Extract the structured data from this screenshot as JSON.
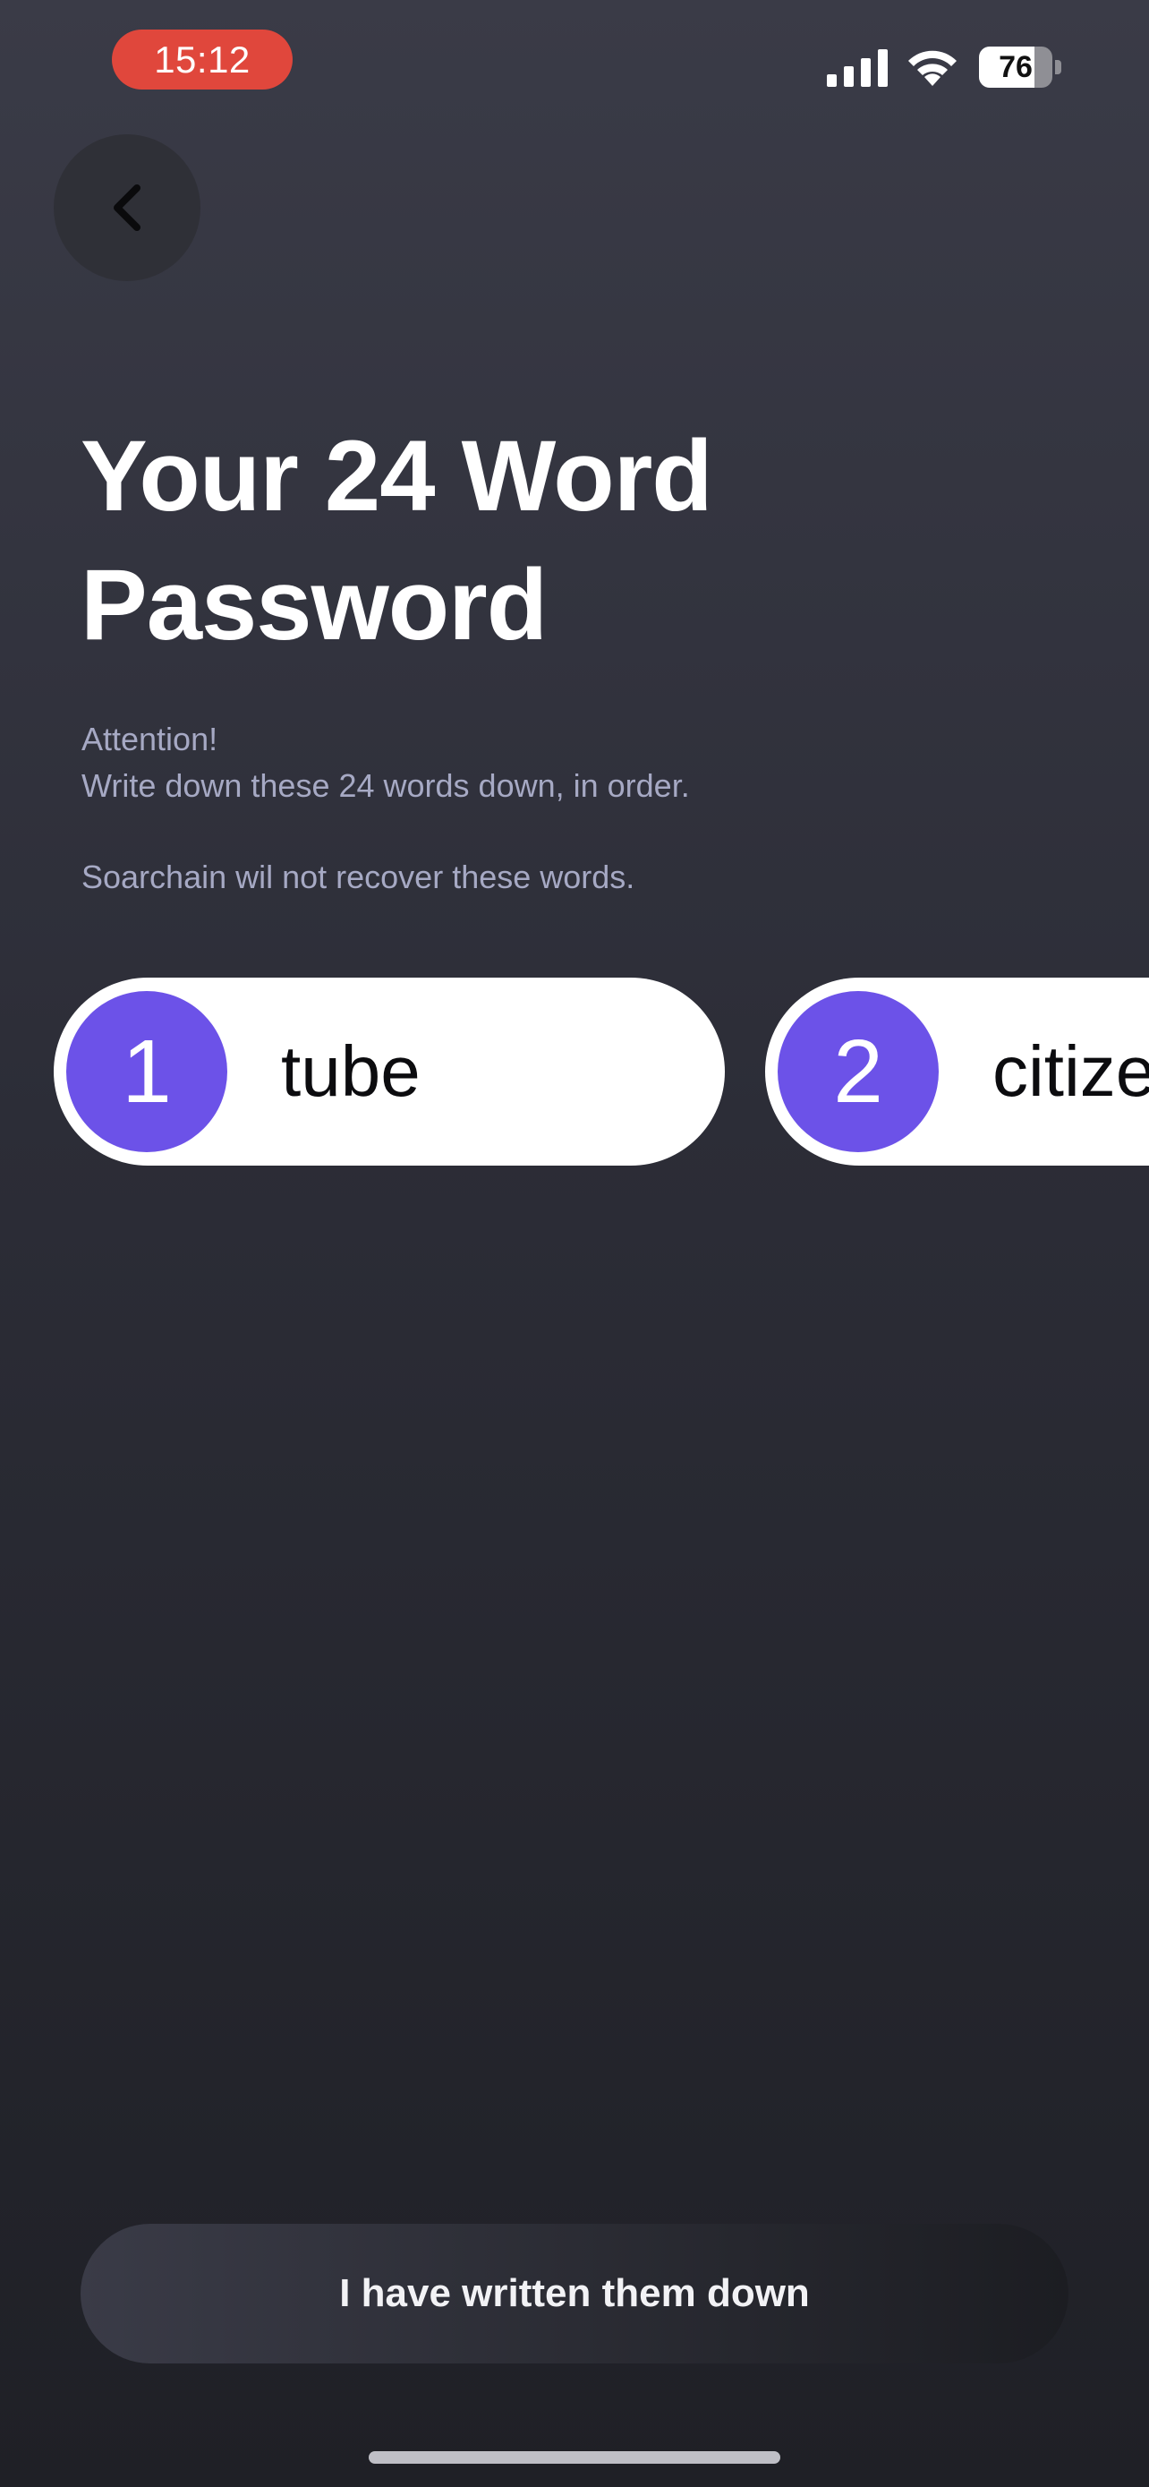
{
  "status_bar": {
    "time": "15:12",
    "battery_level": "76",
    "battery_fraction": 0.76,
    "time_pill_color": "#e0473c"
  },
  "header": {
    "back_icon": "chevron-left-icon"
  },
  "title": {
    "line1": "Your 24 Word",
    "line2": "Password"
  },
  "instructions": {
    "attention": "Attention!",
    "line": "Write down these 24 words down, in order.",
    "note": "Soarchain wil not recover these words."
  },
  "words": [
    {
      "number": "1",
      "word": "tube"
    },
    {
      "number": "2",
      "word": "citize"
    }
  ],
  "colors": {
    "accent": "#6c52e8",
    "card_bg": "#ffffff",
    "instruction_text": "#a6a9c4"
  },
  "footer": {
    "confirm_label": "I have written them down"
  }
}
